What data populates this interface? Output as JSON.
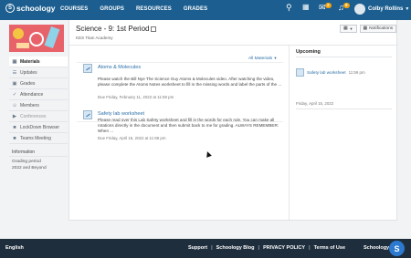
{
  "nav": {
    "logo": "schoology",
    "links": [
      "COURSES",
      "GROUPS",
      "RESOURCES",
      "GRADES"
    ],
    "badges": {
      "messages": "2",
      "notifications": "9"
    },
    "user": "Colby Rollins",
    "icons": [
      "search-icon",
      "grid-icon",
      "mail-icon",
      "bell-icon"
    ]
  },
  "course": {
    "title": "Science - 9: 1st Period",
    "school": "KES Titan Academy"
  },
  "controls": {
    "notifications_label": "Notifications"
  },
  "sidebar": {
    "items": [
      {
        "label": "Materials",
        "icon": "materials-icon"
      },
      {
        "label": "Updates",
        "icon": "updates-icon"
      },
      {
        "label": "Grades",
        "icon": "grades-icon"
      },
      {
        "label": "Attendance",
        "icon": "attendance-icon"
      },
      {
        "label": "Members",
        "icon": "members-icon"
      },
      {
        "label": "Conferences",
        "icon": "conferences-icon"
      },
      {
        "label": "LockDown Browser",
        "icon": "lockdown-icon"
      },
      {
        "label": "Teams Meeting",
        "icon": "teams-icon"
      }
    ],
    "info_header": "Information",
    "info_lines": [
      "Grading period",
      "2022 and Beyond"
    ]
  },
  "materials": {
    "filter_label": "All Materials",
    "items": [
      {
        "title": "Atoms & Molecules",
        "body": "Please watch the Bill Nye The Science Guy Atoms & Molecules video. After watching the video, please complete the Atoms Notes worksheet to fill in the missing words and label the parts of the ...",
        "due": "Due Friday, February 11, 2022 at 11:59 pm"
      },
      {
        "title": "Safety lab worksheet",
        "body": "Please read over this Lab Safety worksheet and fill in the words for each rule. You can make all rotations directly in the document and then submit back to me for grading. ALWAYS REMEMBER: When ...",
        "due": "Due Friday, April 15, 2022 at 11:59 pm"
      }
    ]
  },
  "upcoming": {
    "header": "Upcoming",
    "item_title": "Safety lab worksheet",
    "item_time": "11:59 pm",
    "date": "Friday, April 15, 2022"
  },
  "footer": {
    "language": "English",
    "links": [
      "Support",
      "Schoology Blog",
      "PRIVACY POLICY",
      "Terms of Use"
    ],
    "brand": "Schoology"
  }
}
